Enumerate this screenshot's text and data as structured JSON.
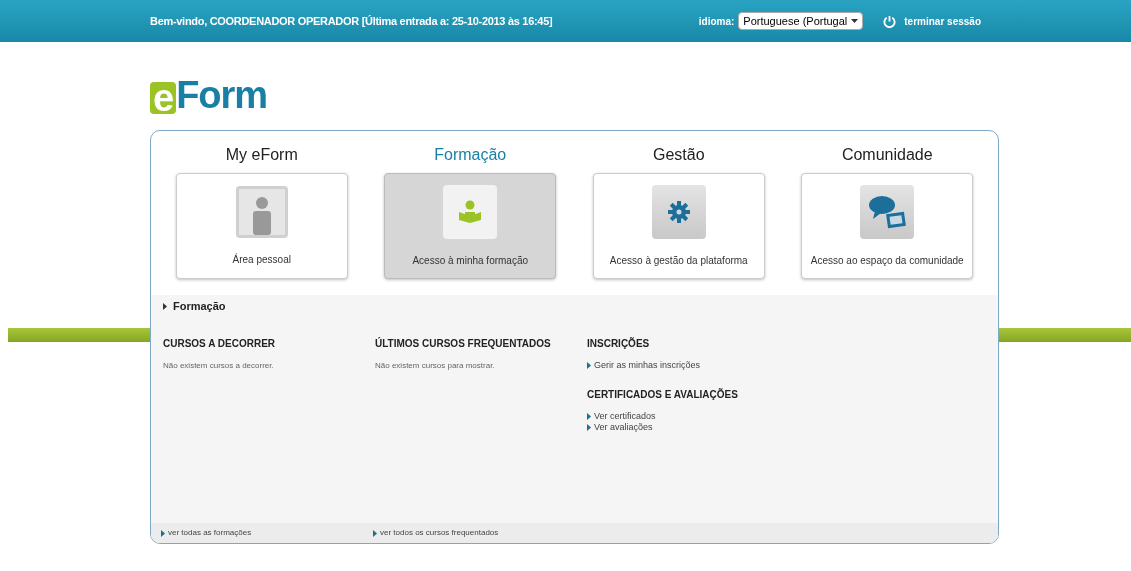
{
  "header": {
    "welcome": "Bem-vindo, COORDENADOR OPERADOR [Última entrada a: 25-10-2013 às 16:45]",
    "language_label": "idioma:",
    "language_value": "Portuguese (Portugal",
    "logout": "terminar sessão"
  },
  "logo": {
    "first": "e",
    "rest": "Form"
  },
  "sections": [
    {
      "title": "My eForm",
      "label": "Área pessoal",
      "selected": false
    },
    {
      "title": "Formação",
      "label": "Acesso à minha formação",
      "selected": true
    },
    {
      "title": "Gestão",
      "label": "Acesso à gestão da plataforma",
      "selected": false
    },
    {
      "title": "Comunidade",
      "label": "Acesso ao espaço da comunidade",
      "selected": false
    }
  ],
  "breadcrumb": "Formação",
  "columns": [
    {
      "blocks": [
        {
          "heading": "CURSOS A DECORRER",
          "text": "Não existem cursos a decorrer."
        }
      ]
    },
    {
      "blocks": [
        {
          "heading": "ÚLTIMOS CURSOS FREQUENTADOS",
          "text": "Não existem cursos para mostrar."
        }
      ]
    },
    {
      "blocks": [
        {
          "heading": "INSCRIÇÕES",
          "links": [
            "Gerir as minhas inscrições"
          ]
        },
        {
          "heading": "CERTIFICADOS E AVALIAÇÕES",
          "links": [
            "Ver certificados",
            "Ver avaliações"
          ]
        }
      ]
    }
  ],
  "footer_links": [
    "ver todas as formações",
    "ver todos os cursos frequentados"
  ]
}
